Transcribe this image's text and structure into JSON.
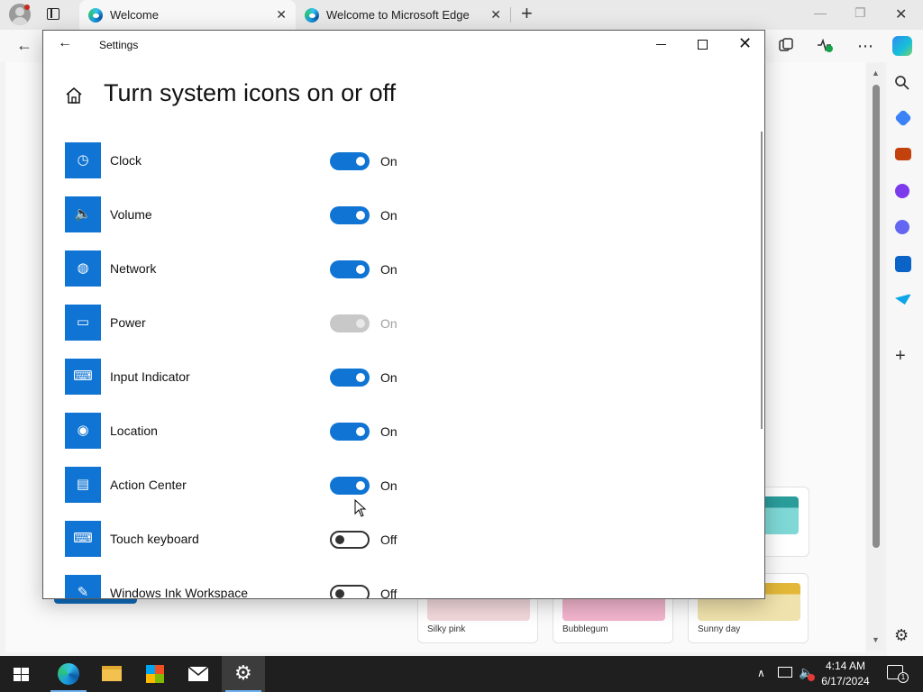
{
  "browser": {
    "tabs": [
      {
        "title": "Welcome",
        "close": "✕"
      },
      {
        "title": "Welcome to Microsoft Edge",
        "close": "✕"
      }
    ],
    "new_tab": "+",
    "window_controls": {
      "minimize": "—",
      "restore": "❐",
      "close": "✕"
    },
    "back": "←",
    "more": "⋯"
  },
  "background_cards": [
    {
      "label": "Silky pink",
      "color": "#f2d9dc"
    },
    {
      "label": "Bubblegum",
      "color": "#f2b4cc"
    },
    {
      "label": "Sunny day",
      "color": "#f0e2ac",
      "accent": "#e3b838"
    }
  ],
  "settings": {
    "window_title": "Settings",
    "back": "←",
    "close": "✕",
    "heading": "Turn system icons on or off",
    "items": [
      {
        "label": "Clock",
        "icon": "clock-icon",
        "glyph": "◷",
        "state": "on",
        "state_label": "On"
      },
      {
        "label": "Volume",
        "icon": "volume-icon",
        "glyph": "🔈",
        "state": "on",
        "state_label": "On"
      },
      {
        "label": "Network",
        "icon": "network-icon",
        "glyph": "◍",
        "state": "on",
        "state_label": "On"
      },
      {
        "label": "Power",
        "icon": "power-icon",
        "glyph": "▭",
        "state": "disabled",
        "state_label": "On"
      },
      {
        "label": "Input Indicator",
        "icon": "keyboard-icon",
        "glyph": "⌨",
        "state": "on",
        "state_label": "On"
      },
      {
        "label": "Location",
        "icon": "location-icon",
        "glyph": "◉",
        "state": "on",
        "state_label": "On"
      },
      {
        "label": "Action Center",
        "icon": "action-center-icon",
        "glyph": "▤",
        "state": "on",
        "state_label": "On"
      },
      {
        "label": "Touch keyboard",
        "icon": "touch-keyboard-icon",
        "glyph": "⌨",
        "state": "off",
        "state_label": "Off"
      },
      {
        "label": "Windows Ink Workspace",
        "icon": "pen-icon",
        "glyph": "✎",
        "state": "off",
        "state_label": "Off"
      }
    ]
  },
  "taskbar": {
    "time": "4:14 AM",
    "date": "6/17/2024",
    "notification_count": "1",
    "apps": [
      "edge-icon",
      "file-explorer-icon",
      "store-icon",
      "mail-icon",
      "settings-icon"
    ]
  },
  "colors": {
    "accent": "#0f74d3",
    "taskbar": "#1f1f1f"
  }
}
